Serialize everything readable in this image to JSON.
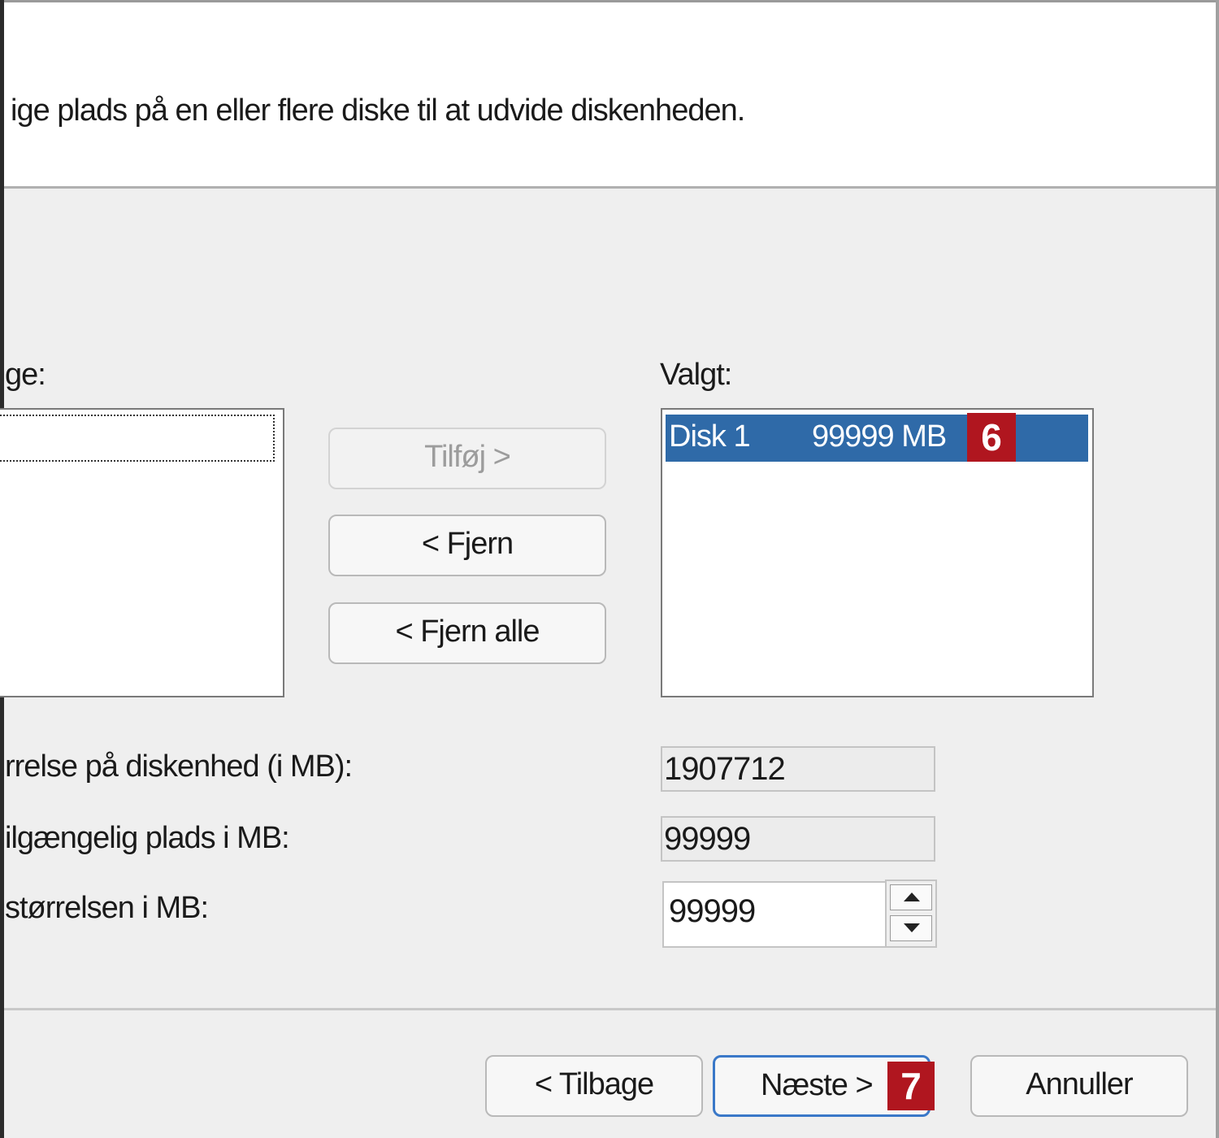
{
  "header": {
    "instruction": "ige plads på en eller flere diske til at udvide diskenheden."
  },
  "available": {
    "label": "ge:"
  },
  "buttons": {
    "add": "Tilføj >",
    "remove": "< Fjern",
    "remove_all": "< Fjern alle"
  },
  "selected": {
    "label": "Valgt:",
    "items": [
      {
        "name": "Disk 1",
        "size": "99999 MB"
      }
    ]
  },
  "fields": {
    "total_label": "rrelse på diskenhed (i MB):",
    "total_value": "1907712",
    "max_label": "ilgængelig plads i MB:",
    "max_value": "99999",
    "size_label": "størrelsen i MB:",
    "size_value": "99999"
  },
  "footer": {
    "back": "< Tilbage",
    "next": "Næste >",
    "cancel": "Annuller"
  },
  "badges": {
    "step6": "6",
    "step7": "7"
  },
  "colors": {
    "selection": "#2f6aa8",
    "badge": "#b0161f",
    "dialog_bg": "#efefef"
  }
}
